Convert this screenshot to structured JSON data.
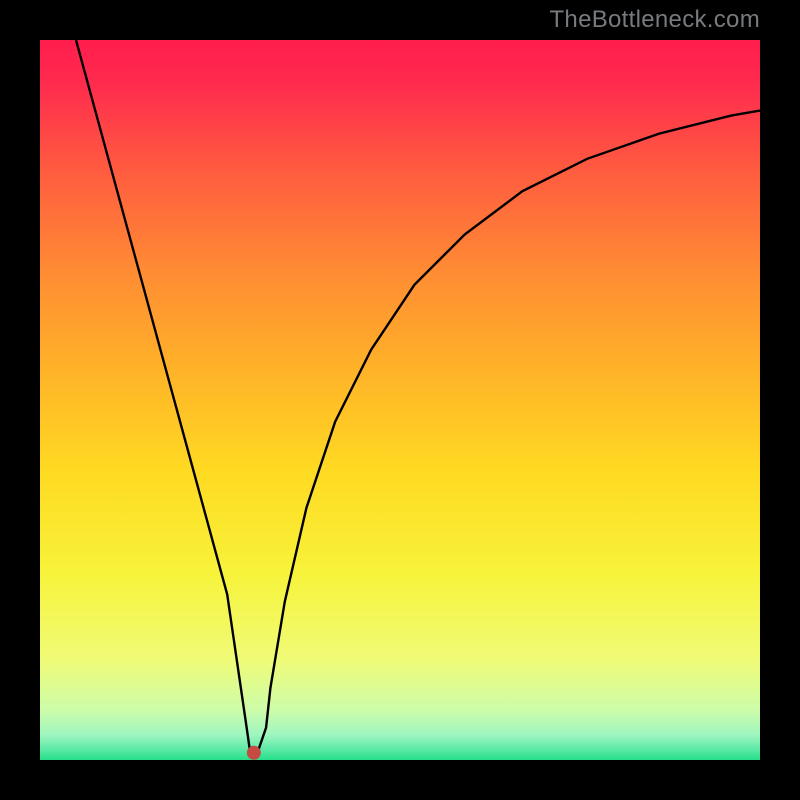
{
  "watermark": "TheBottleneck.com",
  "chart_data": {
    "type": "line",
    "title": "",
    "xlabel": "",
    "ylabel": "",
    "xlim": [
      0,
      100
    ],
    "ylim": [
      0,
      100
    ],
    "grid": false,
    "legend": false,
    "background_gradient_stops": [
      {
        "offset": 0.0,
        "color": "#ff1d4e"
      },
      {
        "offset": 0.06,
        "color": "#ff2b4e"
      },
      {
        "offset": 0.18,
        "color": "#ff5b40"
      },
      {
        "offset": 0.32,
        "color": "#ff8b33"
      },
      {
        "offset": 0.46,
        "color": "#ffb328"
      },
      {
        "offset": 0.6,
        "color": "#ffda22"
      },
      {
        "offset": 0.74,
        "color": "#f7f33a"
      },
      {
        "offset": 0.86,
        "color": "#f0fb76"
      },
      {
        "offset": 0.93,
        "color": "#cdfca9"
      },
      {
        "offset": 0.965,
        "color": "#9ff6bf"
      },
      {
        "offset": 0.985,
        "color": "#5de9a7"
      },
      {
        "offset": 1.0,
        "color": "#27df89"
      }
    ],
    "series": [
      {
        "name": "bottleneck-curve",
        "color": "#000000",
        "x": [
          5,
          8,
          11,
          14,
          17,
          20,
          23,
          26,
          28.7,
          29.2,
          30.2,
          31.4,
          32,
          34,
          37,
          41,
          46,
          52,
          59,
          67,
          76,
          86,
          96,
          100
        ],
        "y": [
          100,
          89,
          78,
          67,
          56,
          45,
          34,
          23,
          4.5,
          1.0,
          1.0,
          4.5,
          10,
          22,
          35,
          47,
          57,
          66,
          73,
          79,
          83.5,
          87,
          89.5,
          90.2
        ]
      }
    ],
    "marker": {
      "x": 29.7,
      "y": 1.0,
      "color": "#c74a42",
      "radius_px": 7
    }
  }
}
